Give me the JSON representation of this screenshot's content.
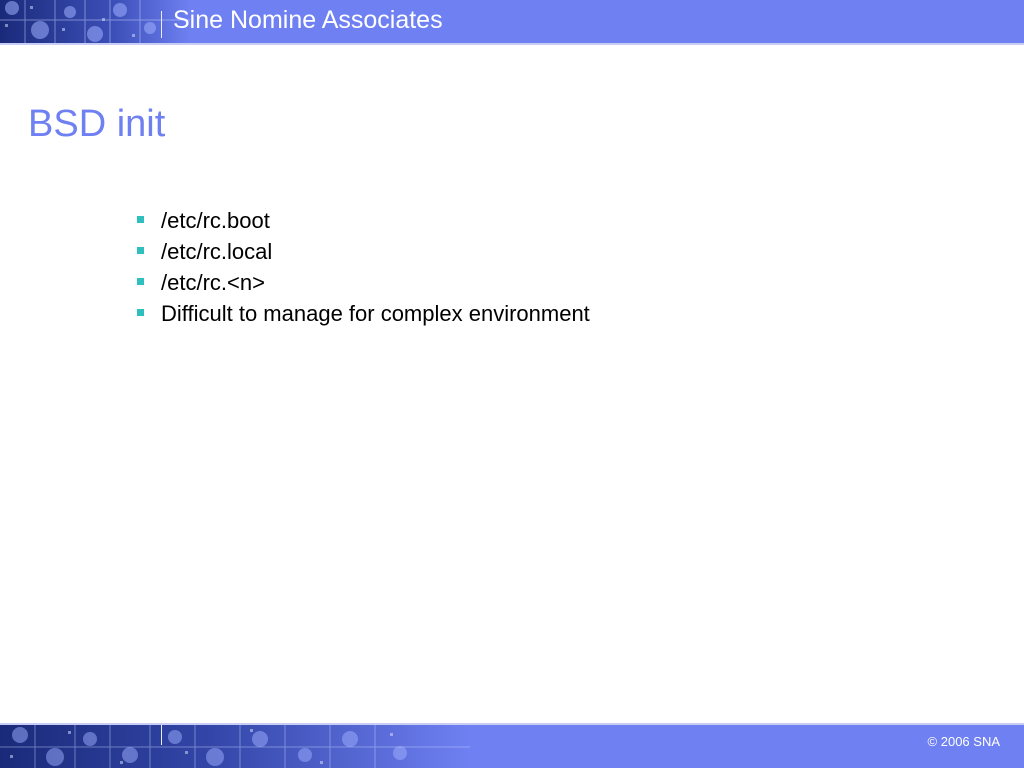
{
  "header": {
    "company_name": "Sine Nomine Associates"
  },
  "slide": {
    "title": "BSD init",
    "bullets": [
      "/etc/rc.boot",
      "/etc/rc.local",
      "/etc/rc.<n>",
      "Difficult to manage for complex environment"
    ]
  },
  "footer": {
    "copyright": "© 2006 SNA"
  },
  "colors": {
    "band": "#6f80f2",
    "title": "#6f80f2",
    "bullet_marker": "#2fbfbf",
    "text": "#000000"
  }
}
